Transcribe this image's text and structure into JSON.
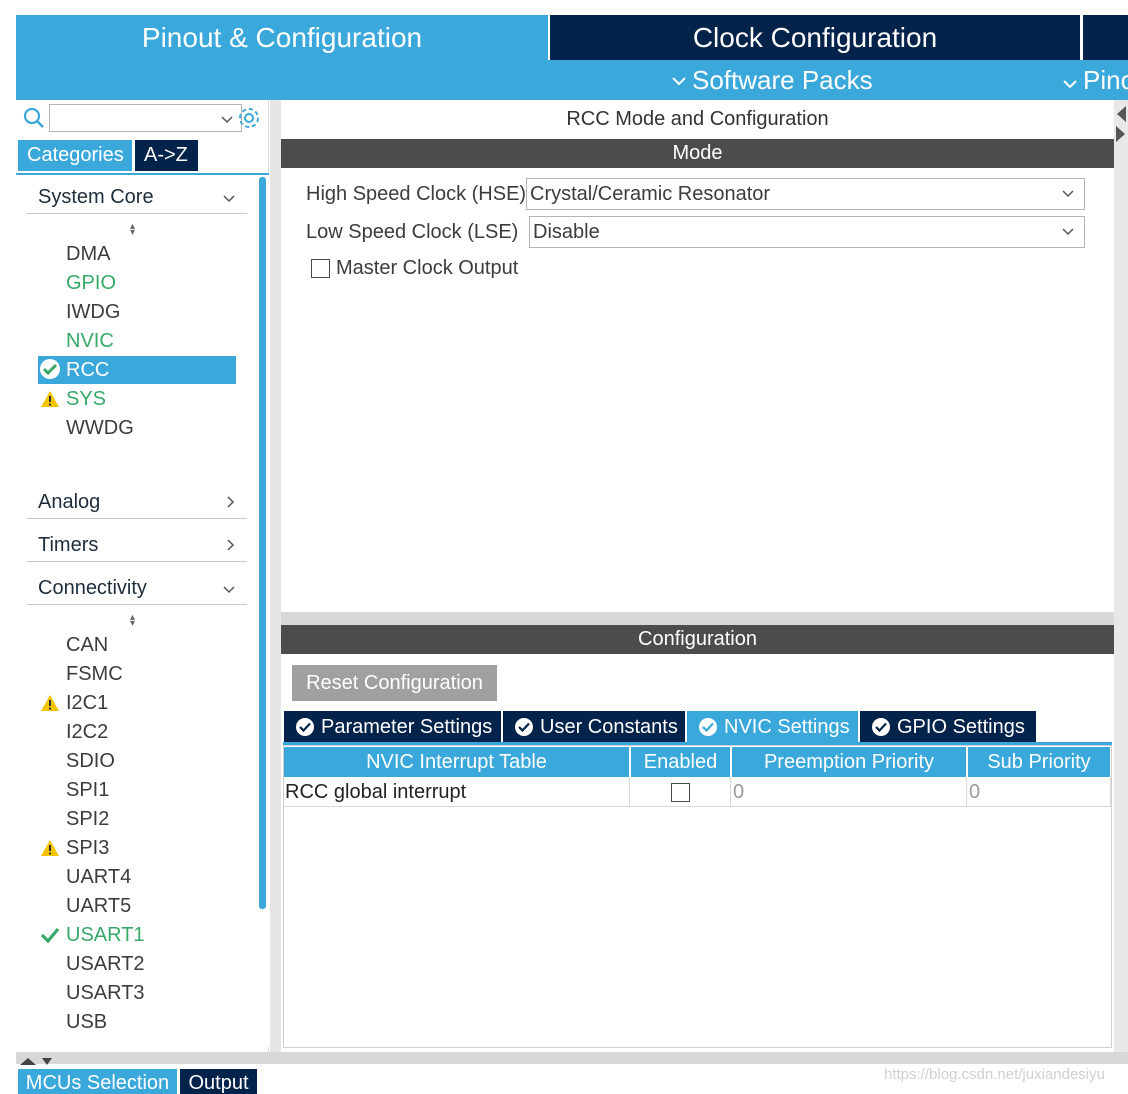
{
  "top_tabs": {
    "pinout": "Pinout & Configuration",
    "clock": "Clock Configuration"
  },
  "subbar": {
    "software_packs": "Software Packs",
    "pinout": "Pino"
  },
  "left": {
    "categories_tab": "Categories",
    "az_tab": "A->Z",
    "system_core": {
      "header": "System Core",
      "items": [
        {
          "label": "DMA",
          "status": "none"
        },
        {
          "label": "GPIO",
          "status": "green"
        },
        {
          "label": "IWDG",
          "status": "none"
        },
        {
          "label": "NVIC",
          "status": "green"
        },
        {
          "label": "RCC",
          "status": "selected-check"
        },
        {
          "label": "SYS",
          "status": "warning"
        },
        {
          "label": "WWDG",
          "status": "none"
        }
      ]
    },
    "analog_header": "Analog",
    "timers_header": "Timers",
    "connectivity": {
      "header": "Connectivity",
      "items": [
        {
          "label": "CAN",
          "status": "none"
        },
        {
          "label": "FSMC",
          "status": "none"
        },
        {
          "label": "I2C1",
          "status": "warning"
        },
        {
          "label": "I2C2",
          "status": "none"
        },
        {
          "label": "SDIO",
          "status": "none"
        },
        {
          "label": "SPI1",
          "status": "none"
        },
        {
          "label": "SPI2",
          "status": "none"
        },
        {
          "label": "SPI3",
          "status": "warning"
        },
        {
          "label": "UART4",
          "status": "none"
        },
        {
          "label": "UART5",
          "status": "none"
        },
        {
          "label": "USART1",
          "status": "check"
        },
        {
          "label": "USART2",
          "status": "none"
        },
        {
          "label": "USART3",
          "status": "none"
        },
        {
          "label": "USB",
          "status": "none"
        }
      ]
    }
  },
  "main": {
    "title": "RCC Mode and Configuration",
    "mode_header": "Mode",
    "hse_label": "High Speed Clock (HSE)",
    "hse_value": "Crystal/Ceramic Resonator",
    "lse_label": "Low Speed Clock (LSE)",
    "lse_value": "Disable",
    "mco_label": "Master Clock Output",
    "config_header": "Configuration",
    "reset_button": "Reset Configuration",
    "tabs": [
      "Parameter Settings",
      "User Constants",
      "NVIC Settings",
      "GPIO Settings"
    ],
    "table": {
      "headers": [
        "NVIC Interrupt Table",
        "Enabled",
        "Preemption Priority",
        "Sub Priority"
      ],
      "rows": [
        {
          "name": "RCC global interrupt",
          "enabled": false,
          "preemption": "0",
          "sub": "0"
        }
      ]
    }
  },
  "bottom": {
    "mcus_tab": "MCUs Selection",
    "output_tab": "Output"
  },
  "watermark": "https://blog.csdn.net/juxiandesiyu",
  "colors": {
    "accent": "#3ba8dc",
    "navy": "#03234b",
    "section_bar": "#4c4c4c",
    "ok_green": "#38a869",
    "warning_yellow": "#f5c400"
  }
}
